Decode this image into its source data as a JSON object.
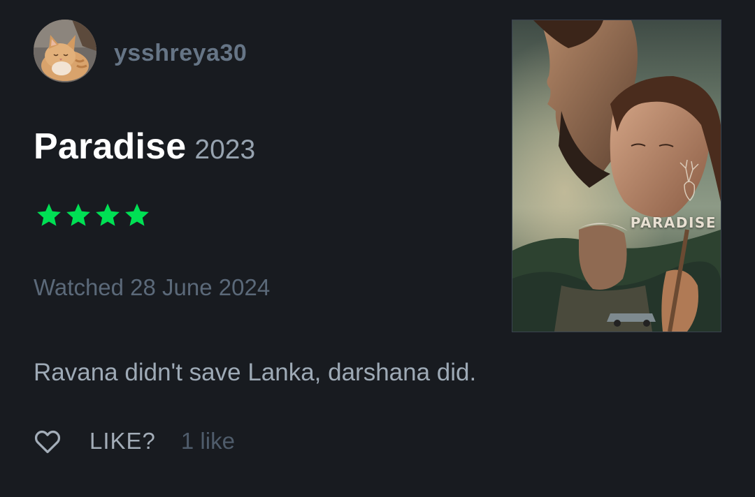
{
  "user": {
    "username": "ysshreya30",
    "avatar_icon": "cat-avatar"
  },
  "film": {
    "title": "Paradise",
    "year": "2023",
    "poster_text": "PARADISE"
  },
  "rating": {
    "stars": 4,
    "max_display": 4,
    "color": "#00e054"
  },
  "watched": "Watched 28 June 2024",
  "review": "Ravana didn't save Lanka, darshana did.",
  "likes": {
    "like_label": "LIKE?",
    "count_text": "1 like",
    "icon": "heart-outline-icon"
  },
  "colors": {
    "background": "#181b20",
    "username": "#667586",
    "accent_green": "#00e054"
  }
}
